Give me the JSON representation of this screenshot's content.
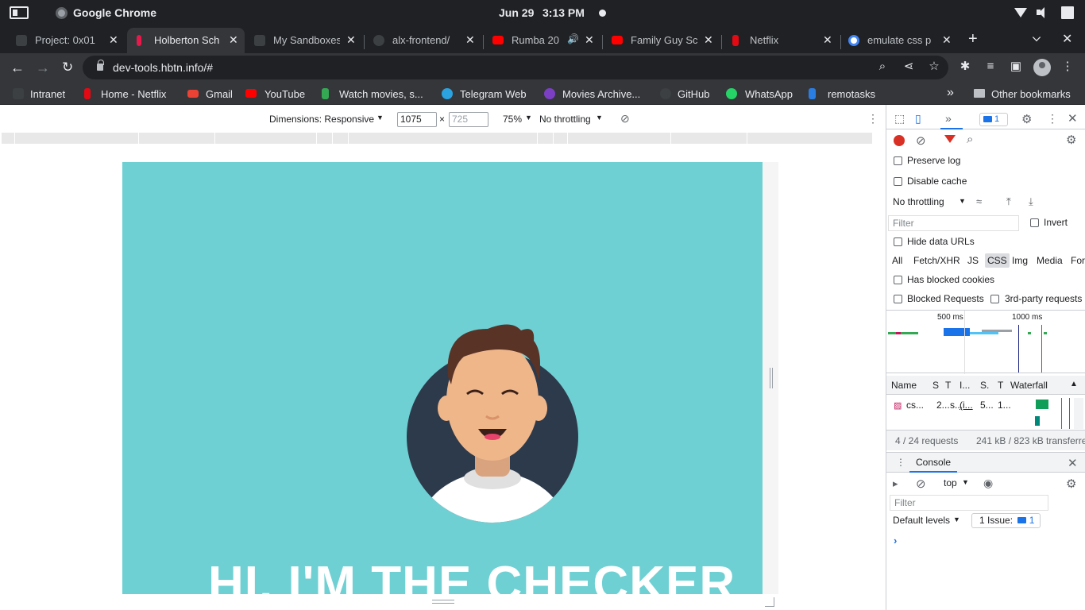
{
  "os": {
    "app_name": "Google Chrome",
    "date": "Jun 29",
    "time": "3:13 PM"
  },
  "tabs": [
    {
      "label": "Project: 0x01",
      "favicon_color": "#3c4043",
      "active": false
    },
    {
      "label": "Holberton Sch",
      "favicon_color": "#e8194a",
      "active": true
    },
    {
      "label": "My Sandboxes",
      "favicon_color": "#3c4043",
      "active": false
    },
    {
      "label": "alx-frontend/",
      "favicon_color": "#3c4043",
      "active": false
    },
    {
      "label": "Rumba 20",
      "favicon_color": "#ff0000",
      "active": false
    },
    {
      "label": "Family Guy Sc",
      "favicon_color": "#ff0000",
      "active": false
    },
    {
      "label": "Netflix",
      "favicon_color": "#e50914",
      "active": false
    },
    {
      "label": "emulate css p",
      "favicon_color": "#ffffff",
      "active": false
    }
  ],
  "toolbar": {
    "url": "dev-tools.hbtn.info/#"
  },
  "bookmarks": [
    {
      "label": "Intranet",
      "icon_color": "#3c4043"
    },
    {
      "label": "Home - Netflix",
      "icon_color": "#e50914"
    },
    {
      "label": "Gmail",
      "icon_color": "#ea4335"
    },
    {
      "label": "YouTube",
      "icon_color": "#ff0000"
    },
    {
      "label": "Watch movies, s...",
      "icon_color": "#34a853"
    },
    {
      "label": "Telegram Web",
      "icon_color": "#2aa3e0"
    },
    {
      "label": "Movies Archive...",
      "icon_color": "#7b3fc4"
    },
    {
      "label": "GitHub",
      "icon_color": "#35363a"
    },
    {
      "label": "WhatsApp",
      "icon_color": "#25d366"
    },
    {
      "label": "remotasks",
      "icon_color": "#2a7de1"
    },
    {
      "label": "Other bookmarks",
      "icon_color": "#bdc1c6"
    }
  ],
  "device_toolbar": {
    "dimensions_label": "Dimensions: Responsive",
    "width": "1075",
    "height_placeholder": "725",
    "zoom": "75%",
    "throttling": "No throttling"
  },
  "page": {
    "background": "#6fd0d3",
    "hero_title": "HI, I'M THE CHECKER"
  },
  "devtools": {
    "issues_count": "1",
    "preserve_log": "Preserve log",
    "disable_cache": "Disable cache",
    "throttling": "No throttling",
    "filter_placeholder": "Filter",
    "invert": "Invert",
    "hide_data_urls": "Hide data URLs",
    "type_filters": [
      "All",
      "Fetch/XHR",
      "JS",
      "CSS",
      "Img",
      "Media",
      "For"
    ],
    "active_type": "CSS",
    "has_blocked_cookies": "Has blocked cookies",
    "blocked_requests": "Blocked Requests",
    "third_party": "3rd-party requests",
    "timeline_labels": [
      "500 ms",
      "1000 ms"
    ],
    "columns": [
      "Name",
      "S",
      "T",
      "I...",
      "S.",
      "T",
      "Waterfall"
    ],
    "row": [
      "cs...",
      "2...",
      "s...",
      "(i...",
      "5...",
      "1..."
    ],
    "summary": {
      "requests": "4 / 24 requests",
      "transferred": "241 kB / 823 kB transferre"
    },
    "console_tab": "Console",
    "context": "top",
    "console_filter_placeholder": "Filter",
    "default_levels": "Default levels",
    "issue_label": "1 Issue:",
    "issue_count": "1"
  }
}
